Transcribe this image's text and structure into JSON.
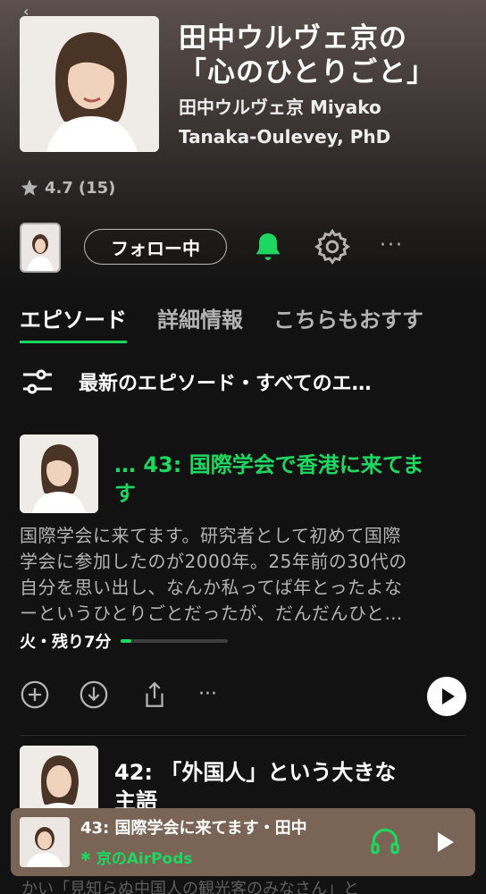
{
  "show": {
    "title_line1": "田中ウルヴェ京の",
    "title_line2": "「心のひとりごと」",
    "author_line1": "田中ウルヴェ京 Miyako",
    "author_line2": "Tanaka-Oulevey, PhD",
    "rating": "4.7",
    "rating_count": "(15)"
  },
  "actions": {
    "follow_label": "フォロー中",
    "more_label": "···"
  },
  "tabs": [
    {
      "label": "エピソード",
      "active": true
    },
    {
      "label": "詳細情報",
      "active": false
    },
    {
      "label": "こちらもおすす",
      "active": false
    }
  ],
  "filter": {
    "label": "最新のエピソード・すべてのエ…"
  },
  "episodes": [
    {
      "title": "… 43: 国際学会で香港に来てま",
      "title_cont": "す",
      "description_lines": [
        "国際学会に来てます。研究者として初めて国際",
        "学会に参加したのが2000年。25年前の30代の",
        "自分を思い出し、なんか私ってば年とったよな",
        "ーというひとりごとだったが、だんだんひと…"
      ],
      "meta": "火・残り7分",
      "progress_fraction": 0.1
    },
    {
      "title": "42: 「外国人」という大きな",
      "title_cont": "主語"
    }
  ],
  "mini_player": {
    "title": "43: 国際学会に来てます・田中",
    "device": "京のAirPods"
  },
  "footer_peek": "かい「見知らぬ中国人の観光客のみなさん」と",
  "colors": {
    "accent": "#1ed760",
    "background": "#121212",
    "mini_player_bg": "#7a6455"
  }
}
